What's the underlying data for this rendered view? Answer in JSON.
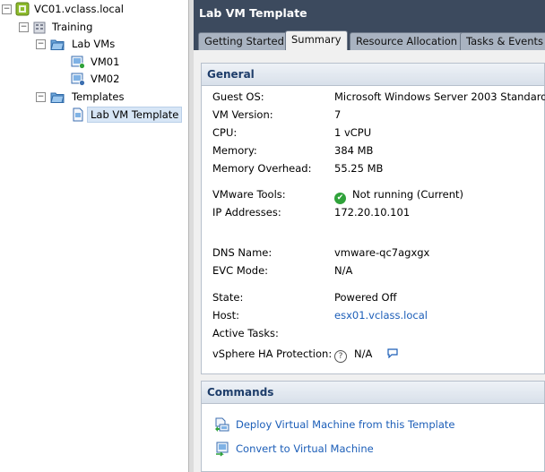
{
  "tree": {
    "items": [
      {
        "label": "VC01.vclass.local",
        "icon": "vcenter-icon",
        "expander": "−"
      },
      {
        "label": "Training",
        "icon": "datacenter-icon",
        "expander": "−"
      },
      {
        "label": "Lab VMs",
        "icon": "folder-icon",
        "expander": "−"
      },
      {
        "label": "VM01",
        "icon": "vm-icon"
      },
      {
        "label": "VM02",
        "icon": "vm-icon"
      },
      {
        "label": "Templates",
        "icon": "folder-icon",
        "expander": "−"
      },
      {
        "label": "Lab VM Template",
        "icon": "template-icon",
        "selected": true
      }
    ]
  },
  "header": {
    "title": "Lab VM Template"
  },
  "tabs": [
    {
      "label": "Getting Started"
    },
    {
      "label": "Summary",
      "active": true
    },
    {
      "label": "Resource Allocation"
    },
    {
      "label": "Tasks & Events"
    }
  ],
  "general": {
    "title": "General",
    "rows": [
      {
        "label": "Guest OS:",
        "value": "Microsoft Windows Server 2003 Standard..."
      },
      {
        "label": "VM Version:",
        "value": "7"
      },
      {
        "label": "CPU:",
        "value": "1 vCPU"
      },
      {
        "label": "Memory:",
        "value": "384 MB"
      },
      {
        "label": "Memory Overhead:",
        "value": "55.25 MB"
      },
      {
        "label": "VMware Tools:",
        "value": "Not running (Current)",
        "icon": "check-circle-icon"
      },
      {
        "label": "IP Addresses:",
        "value": "172.20.10.101"
      },
      {
        "label": "DNS Name:",
        "value": "vmware-qc7agxgx"
      },
      {
        "label": "EVC Mode:",
        "value": "N/A"
      },
      {
        "label": "State:",
        "value": "Powered Off"
      },
      {
        "label": "Host:",
        "value": "esx01.vclass.local",
        "link": true
      },
      {
        "label": "Active Tasks:",
        "value": ""
      },
      {
        "label": "vSphere HA Protection:",
        "value": "N/A",
        "icon": "help-icon",
        "extra_icon": "comment-icon"
      }
    ]
  },
  "commands": {
    "title": "Commands",
    "items": [
      {
        "label": "Deploy Virtual Machine from this Template",
        "icon": "deploy-icon"
      },
      {
        "label": "Convert to Virtual Machine",
        "icon": "convert-icon"
      }
    ]
  },
  "colors": {
    "header_bg": "#3c4a5e",
    "panel_title": "#1e3d6a",
    "link": "#1c5eb8",
    "selected_bg": "#d7e6f6",
    "ok_green": "#2fa23a"
  }
}
